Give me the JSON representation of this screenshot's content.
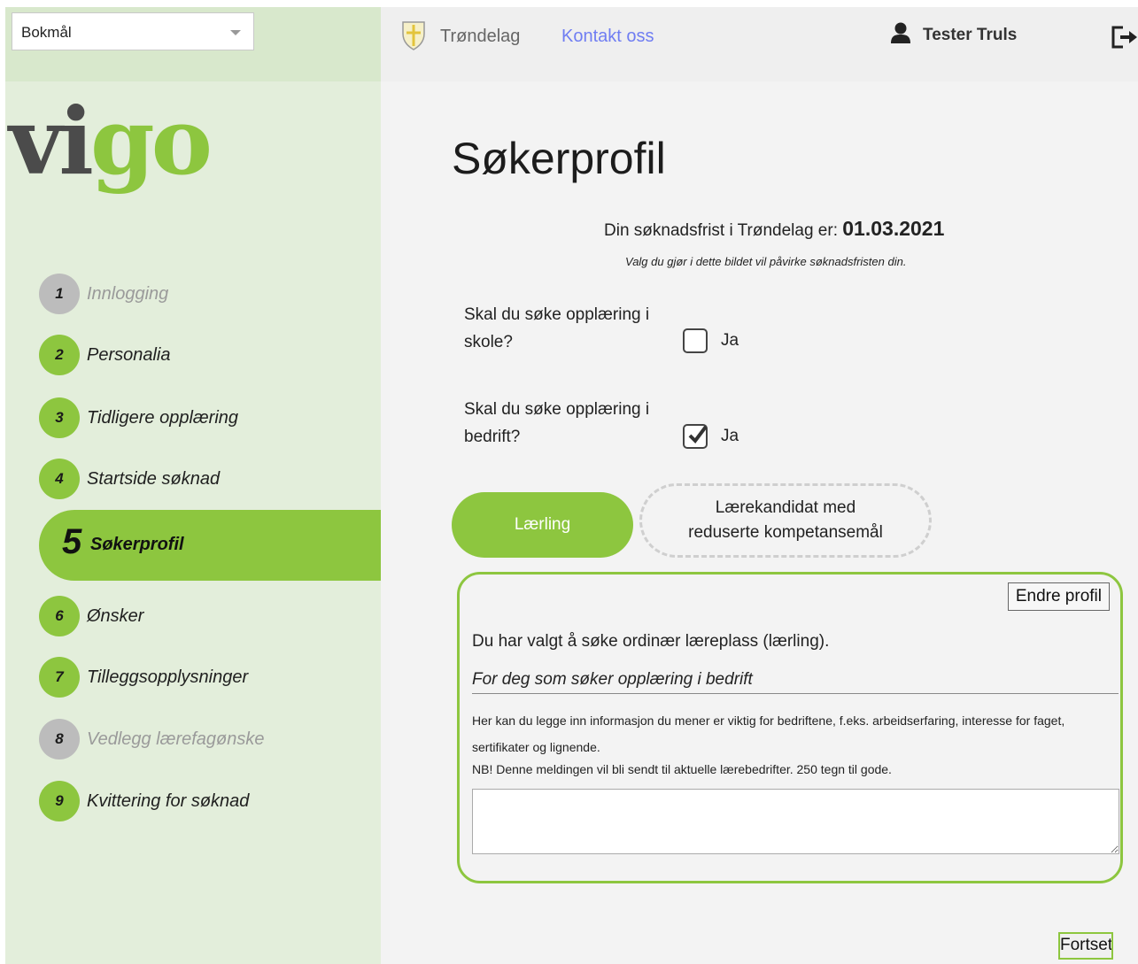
{
  "language_select": {
    "value": "Bokmål"
  },
  "logo": {
    "part1": "vi",
    "part2": "go"
  },
  "header": {
    "region": "Trøndelag",
    "contact": "Kontakt oss",
    "user": "Tester Truls"
  },
  "steps": [
    {
      "num": "1",
      "label": "Innlogging",
      "state": "disabled"
    },
    {
      "num": "2",
      "label": "Personalia",
      "state": "enabled"
    },
    {
      "num": "3",
      "label": "Tidligere opplæring",
      "state": "enabled"
    },
    {
      "num": "4",
      "label": "Startside søknad",
      "state": "enabled"
    },
    {
      "num": "5",
      "label": "Søkerprofil",
      "state": "active"
    },
    {
      "num": "6",
      "label": "Ønsker",
      "state": "enabled"
    },
    {
      "num": "7",
      "label": "Tilleggsopplysninger",
      "state": "enabled"
    },
    {
      "num": "8",
      "label": "Vedlegg lærefagønske",
      "state": "disabled"
    },
    {
      "num": "9",
      "label": "Kvittering for søknad",
      "state": "enabled"
    }
  ],
  "main": {
    "title": "Søkerprofil",
    "deadline_text": "Din søknadsfrist i Trøndelag er: ",
    "deadline_date": "01.03.2021",
    "deadline_note": "Valg du gjør i dette bildet vil påvirke søknadsfristen din.",
    "q_school_line1": "Skal du søke opplæring i",
    "q_school_line2": "skole?",
    "q_school_option": "Ja",
    "q_school_checked": false,
    "q_company_line1": "Skal du søke opplæring i",
    "q_company_line2": "bedrift?",
    "q_company_option": "Ja",
    "q_company_checked": true,
    "btn_laerling": "Lærling",
    "btn_kandidat_line1": "Lærekandidat med",
    "btn_kandidat_line2": "reduserte kompetansemål",
    "panel": {
      "edit_button": "Endre profil",
      "chosen": "Du har valgt å søke ordinær læreplass (lærling).",
      "subheading": "For deg som søker opplæring i bedrift",
      "info": "Her kan du legge inn informasjon du mener er viktig for bedriftene, f.eks. arbeidserfaring, interesse for faget, sertifikater og lignende.",
      "nb": "NB! Denne meldingen vil bli sendt til aktuelle lærebedrifter. 250 tegn til gode.",
      "message_value": ""
    },
    "continue_button": "Fortsett"
  },
  "colors": {
    "accent": "#8dc63f",
    "link": "#6f7df2",
    "sidebar": "#e3eedb"
  }
}
